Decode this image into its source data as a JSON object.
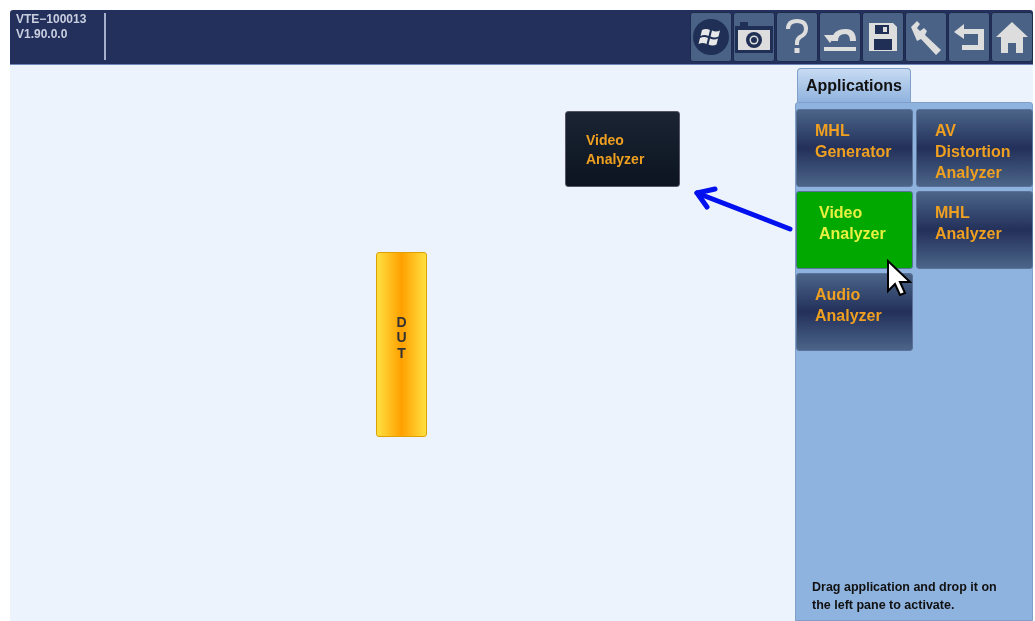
{
  "header": {
    "device": "VTE−100013",
    "version": "V1.90.0.0"
  },
  "toolbar": [
    {
      "kind": "windows"
    },
    {
      "kind": "camera"
    },
    {
      "kind": "help"
    },
    {
      "kind": "undo"
    },
    {
      "kind": "save"
    },
    {
      "kind": "settings"
    },
    {
      "kind": "back"
    },
    {
      "kind": "home"
    }
  ],
  "canvas": {
    "blocks": [
      {
        "kind": "application",
        "label": "Video Analyzer"
      },
      {
        "kind": "dut",
        "label": "DUT"
      }
    ]
  },
  "panel": {
    "tabs": [
      {
        "label": "Applications",
        "selected": true
      }
    ],
    "applications": [
      {
        "label": "MHL Generator",
        "selected": false
      },
      {
        "label": "AV Distortion Analyzer",
        "selected": false
      },
      {
        "label": "Video Analyzer",
        "selected": true
      },
      {
        "label": "MHL Analyzer",
        "selected": false
      },
      {
        "label": "Audio Analyzer",
        "selected": false
      }
    ],
    "hint": "Drag application and drop it on the left pane to activate."
  }
}
